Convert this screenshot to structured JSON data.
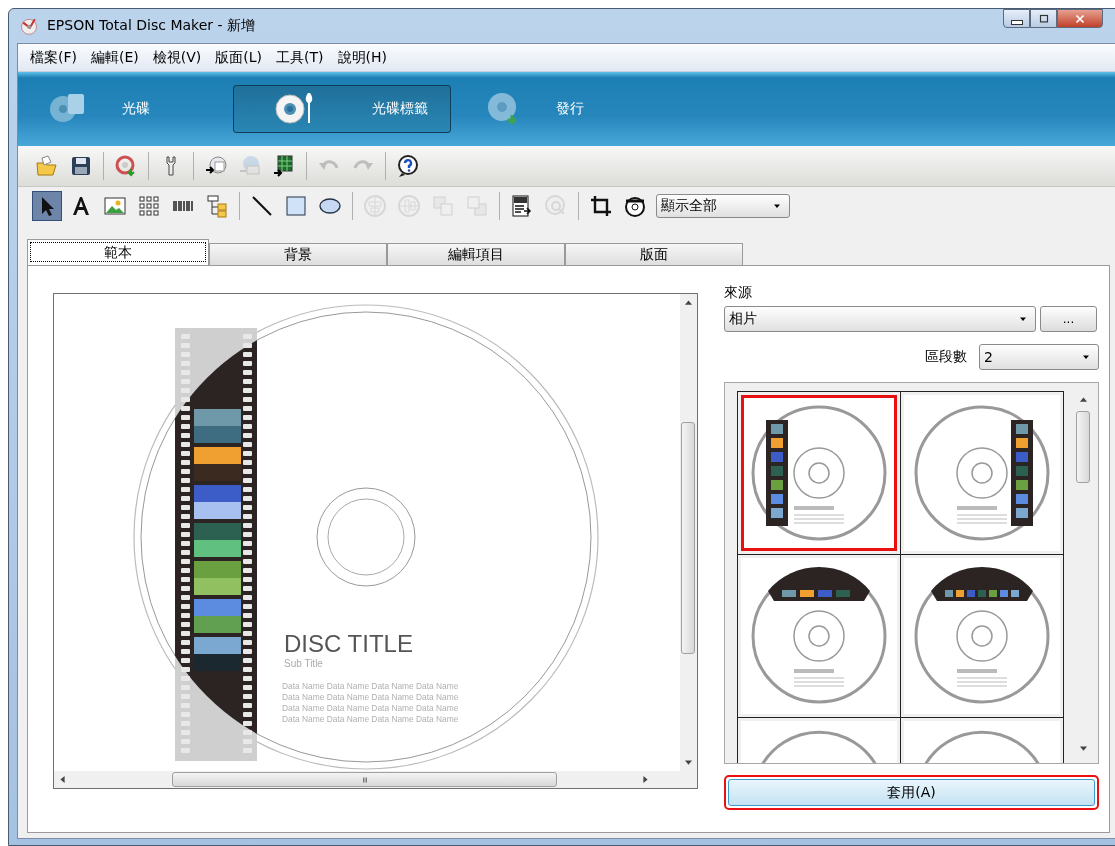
{
  "window": {
    "title": "EPSON Total Disc Maker - 新增"
  },
  "menu": [
    "檔案(F)",
    "編輯(E)",
    "檢視(V)",
    "版面(L)",
    "工具(T)",
    "說明(H)"
  ],
  "mode_tabs": [
    {
      "label": "光碟",
      "selected": false
    },
    {
      "label": "光碟標籤",
      "selected": true
    },
    {
      "label": "發行",
      "selected": false
    }
  ],
  "toolbar": [
    {
      "disabled": false
    },
    {
      "disabled": false
    },
    {
      "disabled": false
    },
    {
      "disabled": false
    },
    {
      "disabled": false
    },
    {
      "disabled": true
    },
    {
      "disabled": false
    },
    {
      "disabled": true
    },
    {
      "disabled": true
    },
    {
      "disabled": false
    }
  ],
  "drawing_tools": [
    {
      "selected": true,
      "disabled": false
    },
    {
      "selected": false,
      "disabled": false
    },
    {
      "selected": false,
      "disabled": false
    },
    {
      "selected": false,
      "disabled": false
    },
    {
      "selected": false,
      "disabled": false
    },
    {
      "selected": false,
      "disabled": false
    },
    {
      "selected": false,
      "disabled": false
    },
    {
      "selected": false,
      "disabled": false
    },
    {
      "selected": false,
      "disabled": false
    },
    {
      "selected": false,
      "disabled": true
    },
    {
      "selected": false,
      "disabled": true
    },
    {
      "selected": false,
      "disabled": true
    },
    {
      "selected": false,
      "disabled": true
    },
    {
      "selected": false,
      "disabled": false
    },
    {
      "selected": false,
      "disabled": true
    },
    {
      "selected": false,
      "disabled": false
    },
    {
      "selected": false,
      "disabled": false
    }
  ],
  "view_select": {
    "value": "顯示全部"
  },
  "tabs": [
    {
      "label": "範本",
      "selected": true
    },
    {
      "label": "背景",
      "selected": false
    },
    {
      "label": "編輯項目",
      "selected": false
    },
    {
      "label": "版面",
      "selected": false
    }
  ],
  "preview": {
    "title": "DISC TITLE",
    "subtitle": "Sub Title",
    "data_lines": [
      "Data Name Data Name Data Name Data Name",
      "Data Name Data Name Data Name Data Name",
      "Data Name Data Name Data Name Data Name",
      "Data Name Data Name Data Name Data Name"
    ]
  },
  "source": {
    "label": "來源",
    "value": "相片",
    "browse_button": "..."
  },
  "segments": {
    "label": "區段數",
    "value": "2"
  },
  "templates": [
    {
      "kind": "left-strip",
      "selected": true
    },
    {
      "kind": "right-strip",
      "selected": false
    },
    {
      "kind": "top-strip-large",
      "selected": false
    },
    {
      "kind": "top-strip-small",
      "selected": false
    },
    {
      "kind": "plain",
      "selected": false
    },
    {
      "kind": "plain",
      "selected": false
    }
  ],
  "apply_button": {
    "label": "套用(A)",
    "highlighted": true
  }
}
